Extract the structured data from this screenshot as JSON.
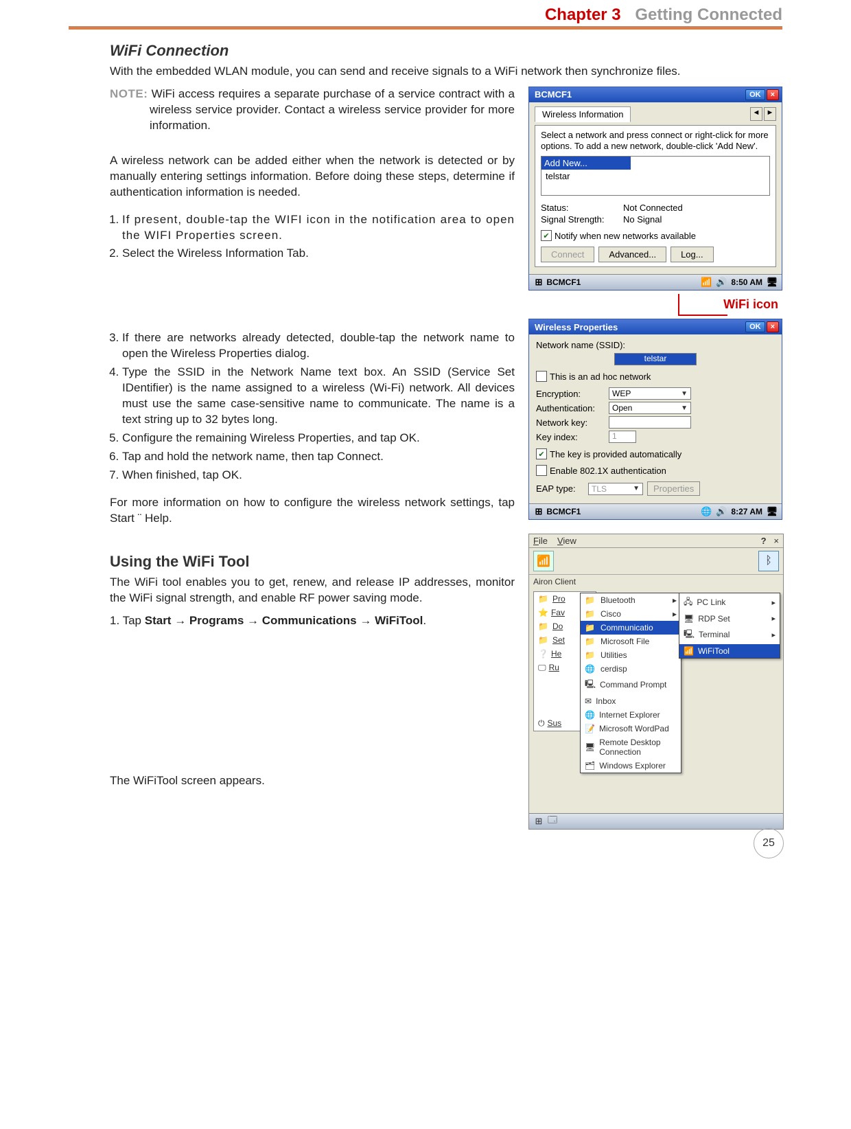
{
  "header": {
    "chapter": "Chapter 3",
    "title": "Getting Connected"
  },
  "section": {
    "h_wifi": "WiFi Connection",
    "intro": "With the embedded WLAN module, you can send and receive signals to a WiFi network then synchronize files.",
    "note_label": "NOTE:",
    "note_text": "WiFi access requires a separate purchase of a service contract with a wireless service provider. Contact a wireless service provider for more information.",
    "p_add": "A wireless network can be added either when the network is detected or by manually entering settings information. Before doing these steps, determine if authentication information is needed.",
    "steps_a": [
      "If present, double-tap the WIFI icon in the notification area to open the WIFI Properties screen.",
      "Select the Wireless Information Tab."
    ],
    "steps_b": [
      "If there are networks already detected, double-tap the network name to open the Wireless Properties dialog.",
      "Type the SSID in the Network Name text box. An SSID (Service Set IDentifier) is the name assigned to a wireless (Wi-Fi) network. All devices must use the same case-sensitive name to communicate. The name is a text string up to 32 bytes long.",
      "Configure the remaining Wireless Properties, and tap OK.",
      "Tap and hold the network name, then tap Connect.",
      "When finished, tap OK."
    ],
    "p_more": "For more information on how to configure the wireless network settings, tap Start ¨ Help.",
    "h_tool": "Using the WiFi Tool",
    "tool_intro": "The WiFi tool enables you to get, renew, and release IP addresses, monitor the WiFi signal strength, and enable RF power saving mode.",
    "tool_step_prefix": "1. Tap ",
    "tool_step_path": "Start → Programs → Communications → WiFiTool",
    "tool_step_suffix": ".",
    "tool_result": "The WiFiTool screen appears."
  },
  "wifi_icon_label": "WiFi icon",
  "ss1": {
    "title": "BCMCF1",
    "ok": "OK",
    "tab": "Wireless Information",
    "help": "Select a network and press connect or right-click for more options.  To add a new network, double-click 'Add New'.",
    "add_new": "Add New...",
    "item": "telstar",
    "status_k": "Status:",
    "status_v": "Not Connected",
    "signal_k": "Signal Strength:",
    "signal_v": "No Signal",
    "notify": "Notify when new networks available",
    "connect": "Connect",
    "advanced": "Advanced...",
    "log": "Log...",
    "taskbar_app": "BCMCF1",
    "time": "8:50 AM"
  },
  "ss2": {
    "title": "Wireless Properties",
    "ok": "OK",
    "ssid_lbl": "Network name (SSID):",
    "ssid_val": "telstar",
    "adhoc": "This is an ad hoc network",
    "enc_lbl": "Encryption:",
    "enc_val": "WEP",
    "auth_lbl": "Authentication:",
    "auth_val": "Open",
    "key_lbl": "Network key:",
    "key_val": "",
    "idx_lbl": "Key index:",
    "idx_val": "1",
    "auto": "The key is provided automatically",
    "dot1x": "Enable 802.1X authentication",
    "eap_lbl": "EAP type:",
    "eap_val": "TLS",
    "props": "Properties",
    "taskbar_app": "BCMCF1",
    "time": "8:27 AM"
  },
  "ss3": {
    "file": "File",
    "view": "View",
    "client": "Airon Client",
    "start_items": [
      "Pro",
      "Fav",
      "Do",
      "Set",
      "He",
      "Ru",
      "Sus"
    ],
    "mid_items": [
      "Bluetooth",
      "Cisco",
      "Communicatio",
      "Microsoft File",
      "Utilities",
      "cerdisp",
      "Command Prompt",
      "Inbox",
      "Internet Explorer",
      "Microsoft WordPad",
      "Remote Desktop Connection",
      "Windows Explorer"
    ],
    "right_items": [
      "PC Link",
      "RDP Set",
      "Terminal",
      "WiFiTool"
    ]
  },
  "page_number": "25"
}
